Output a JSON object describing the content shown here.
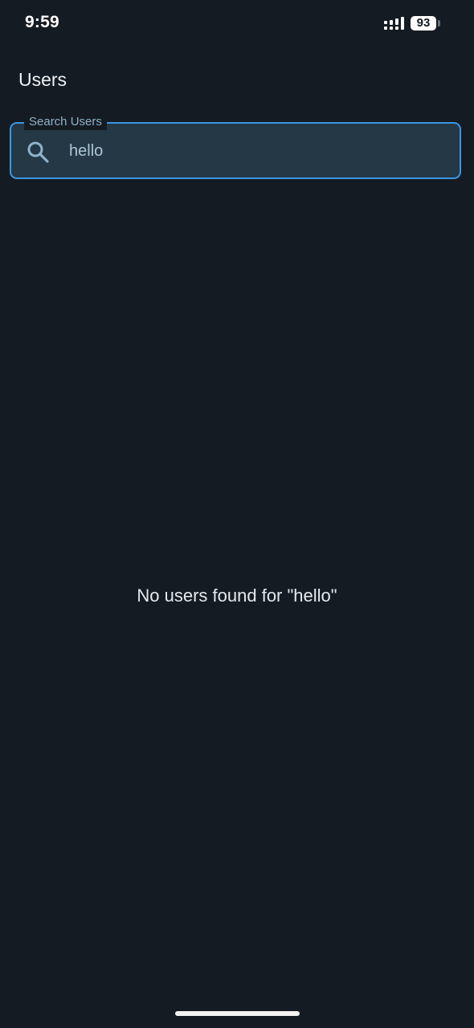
{
  "status_bar": {
    "time": "9:59",
    "battery_level": "93",
    "signal_icon": "signal-icon"
  },
  "app_bar": {
    "title": "Users"
  },
  "search": {
    "label": "Search Users",
    "value": "hello",
    "icon": "search-icon",
    "accent_color": "#3b97e3"
  },
  "results": {
    "empty_message": "No users found for \"hello\""
  },
  "colors": {
    "background": "#151b22",
    "field_fill": "#243845"
  }
}
